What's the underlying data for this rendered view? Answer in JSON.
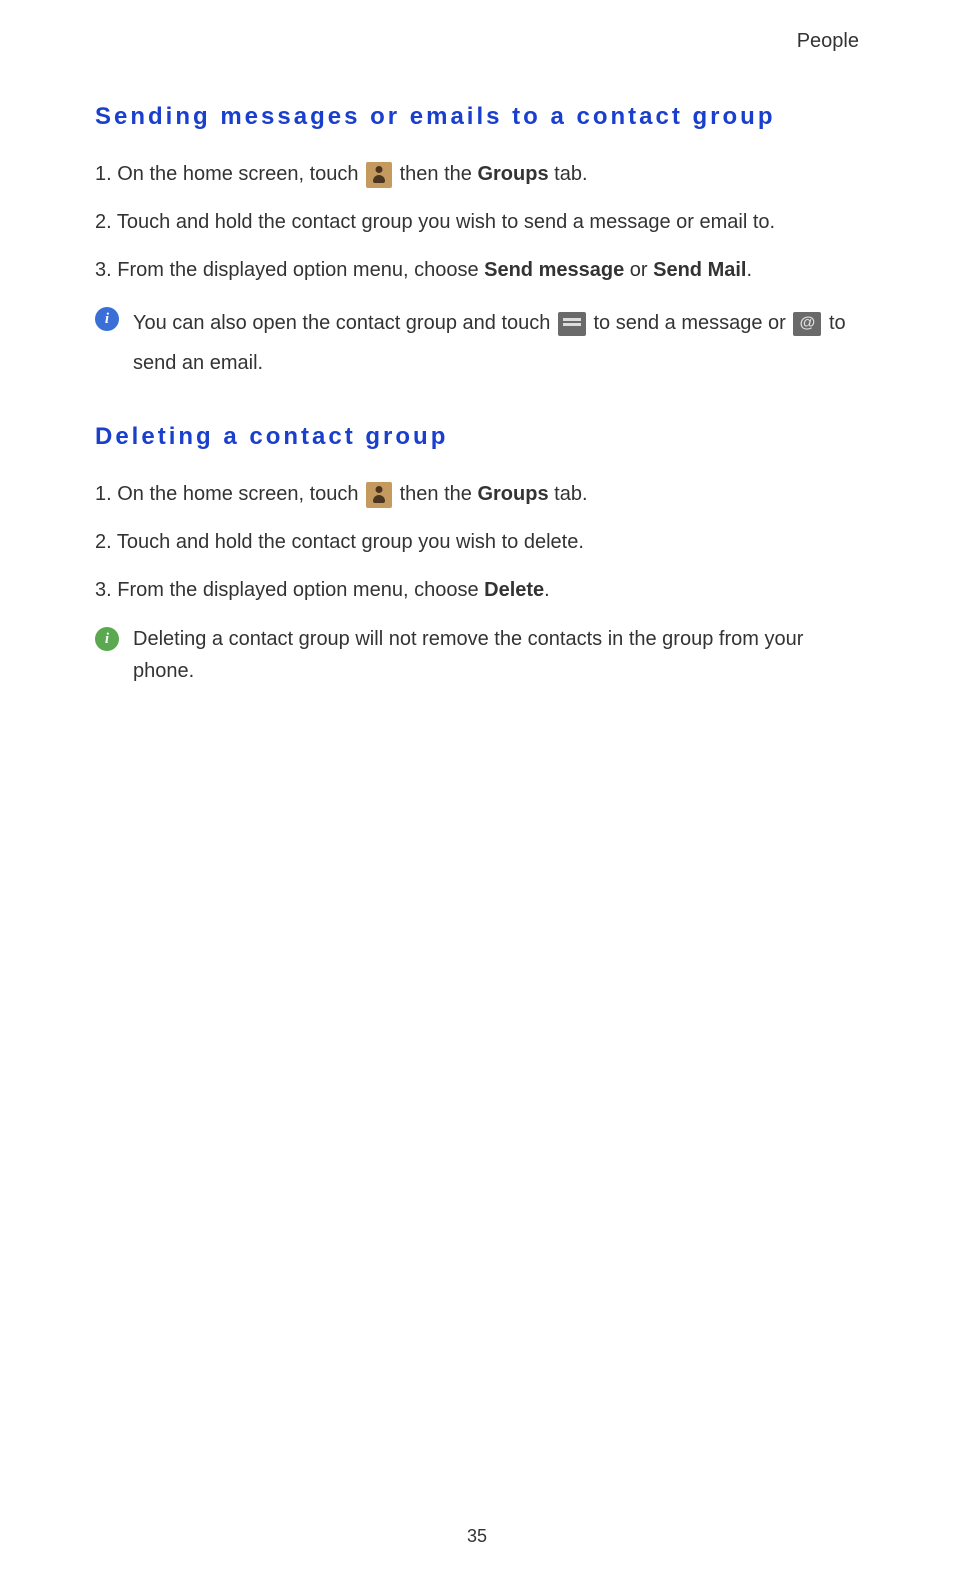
{
  "header": {
    "right": "People"
  },
  "section1": {
    "heading": "Sending messages or emails to a contact group",
    "item1_a": "1.",
    "item1_b": "On the home screen, touch ",
    "item1_c": " then the ",
    "item1_d": "Groups",
    "item1_e": " tab.",
    "item2_a": "2.",
    "item2_b": "Touch and hold the contact group you wish to send a message or email to.",
    "item3_a": "3.",
    "item3_b": "From the displayed option menu, choose ",
    "item3_c": "Send message",
    "item3_d": " or ",
    "item3_e": "Send Mail",
    "item3_f": ".",
    "info_a": "You can also open the contact group and touch ",
    "info_b": " to send a message or ",
    "info_c": " to send an email."
  },
  "section2": {
    "heading": "Deleting a contact group",
    "item1_a": "1.",
    "item1_b": "On the home screen, touch ",
    "item1_c": " then the ",
    "item1_d": "Groups",
    "item1_e": " tab.",
    "item2_a": "2.",
    "item2_b": "Touch and hold the contact group you wish to delete.",
    "item3_a": "3.",
    "item3_b": "From the displayed option menu, choose ",
    "item3_c": "Delete",
    "item3_d": ".",
    "info": "Deleting a contact group will not remove the contacts in the group from your phone."
  },
  "footer": {
    "page": "35"
  }
}
